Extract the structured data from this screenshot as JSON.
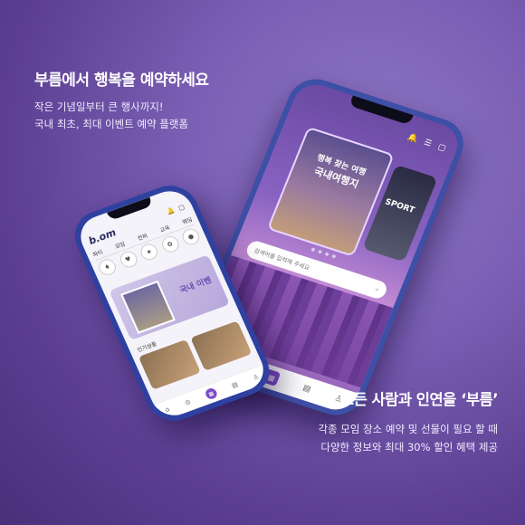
{
  "hero": {
    "headline": "부름에서 행복을 예약하세요",
    "sub_line1": "작은 기념일부터 큰 행사까지!",
    "sub_line2": "국내 최초, 최대 이벤트 예약 플랫폼"
  },
  "promo": {
    "title": "모든 사람과 인연을 ‘부름’",
    "line1": "각종 모임 장소 예약 및 선물이 필요 할 때",
    "line2": "다양한 정보와 최대 30% 할인 혜택 제공"
  },
  "back_phone": {
    "card_title_small": "행복 찾는 여행",
    "card_title": "국내여행지",
    "card2_label": "SPORT",
    "search_placeholder": "검색어를 입력해 주세요"
  },
  "front_phone": {
    "logo": "b.om",
    "tabs": [
      "파티",
      "모임",
      "컨퍼",
      "교육",
      "웨딩"
    ],
    "banner_text": "국내 이벤",
    "section_label": "인기상품"
  }
}
